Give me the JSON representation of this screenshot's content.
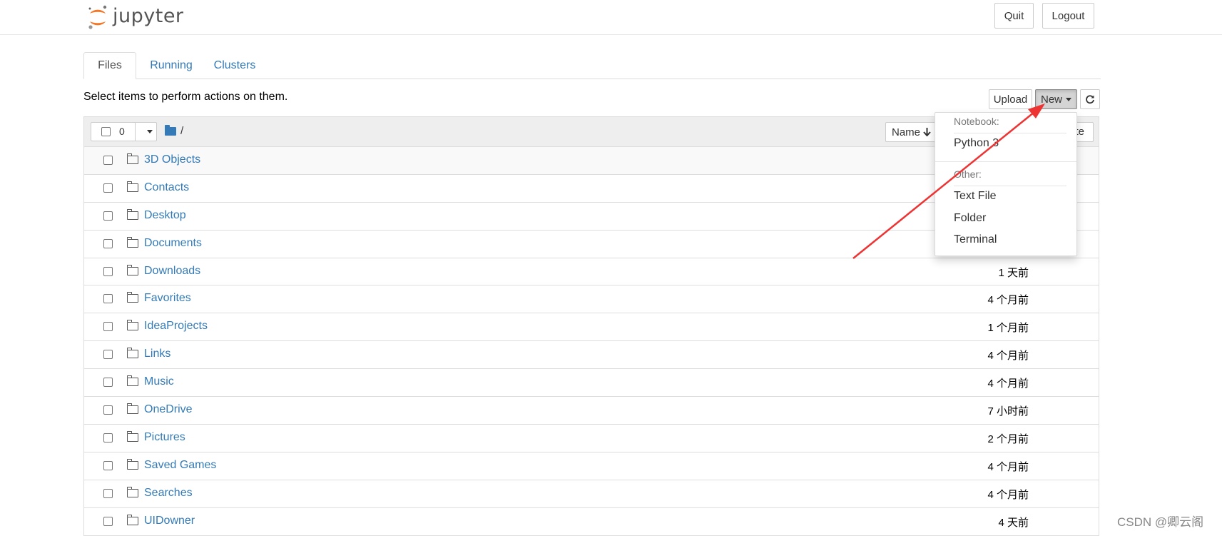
{
  "header": {
    "logo_text": "jupyter",
    "quit_label": "Quit",
    "logout_label": "Logout"
  },
  "tabs": [
    {
      "label": "Files",
      "active": true
    },
    {
      "label": "Running",
      "active": false
    },
    {
      "label": "Clusters",
      "active": false
    }
  ],
  "toolbar": {
    "hint": "Select items to perform actions on them.",
    "upload_label": "Upload",
    "new_label": "New",
    "refresh_icon": "refresh-icon"
  },
  "list_header": {
    "selected_count": "0",
    "path": "/",
    "sort_name_label": "Name",
    "sort_name_icon": "arrow-down-icon",
    "sort_modified_partial": "te"
  },
  "files": [
    {
      "name": "3D Objects",
      "modified": ""
    },
    {
      "name": "Contacts",
      "modified": ""
    },
    {
      "name": "Desktop",
      "modified": ""
    },
    {
      "name": "Documents",
      "modified": ""
    },
    {
      "name": "Downloads",
      "modified": "1 天前"
    },
    {
      "name": "Favorites",
      "modified": "4 个月前"
    },
    {
      "name": "IdeaProjects",
      "modified": "1 个月前"
    },
    {
      "name": "Links",
      "modified": "4 个月前"
    },
    {
      "name": "Music",
      "modified": "4 个月前"
    },
    {
      "name": "OneDrive",
      "modified": "7 小时前"
    },
    {
      "name": "Pictures",
      "modified": "2 个月前"
    },
    {
      "name": "Saved Games",
      "modified": "4 个月前"
    },
    {
      "name": "Searches",
      "modified": "4 个月前"
    },
    {
      "name": "UIDowner",
      "modified": "4 天前"
    }
  ],
  "new_menu": {
    "notebook_header": "Notebook:",
    "python_item": "Python 3",
    "other_header": "Other:",
    "text_file_item": "Text File",
    "folder_item": "Folder",
    "terminal_item": "Terminal"
  },
  "annotation": {
    "arrow_color": "#ee3333"
  },
  "watermark": "CSDN @卿云阁",
  "colors": {
    "link": "#337ab7",
    "logo_orange": "#f37726"
  }
}
